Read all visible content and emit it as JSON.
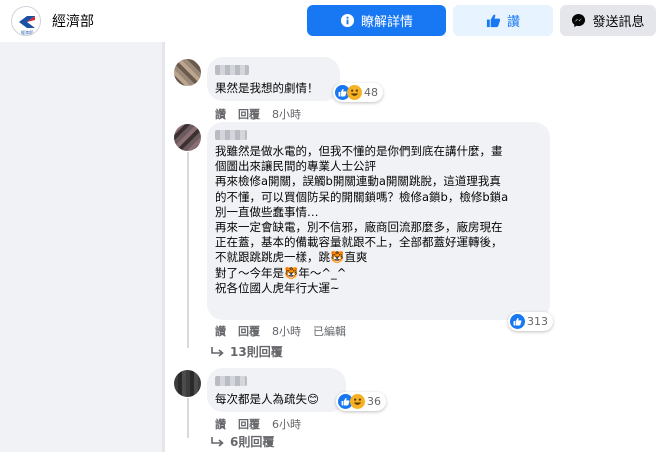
{
  "header": {
    "logo_text": "經濟部",
    "page_name": "經濟部",
    "learn_more": "瞭解詳情",
    "like": "讚",
    "send_message": "發送訊息"
  },
  "comments": [
    {
      "text": "果然是我想的劇情！",
      "reaction_count": "48",
      "actions": [
        "讚",
        "回覆",
        "8小時"
      ]
    },
    {
      "lines": [
        "我雖然是做水電的，但我不懂的是你們到底在講什麼，畫",
        "個圖出來讓民間的專業人士公評",
        "再來檢修a開關，誤觸b開關連動a開關跳脫，這道理我真",
        "的不懂，可以買個防呆的開關鎖嗎？檢修a鎖b，檢修b鎖a",
        "別一直做些蠢事情…",
        "再來一定會缺電，別不信邪，廠商回流那麼多，廠房現在",
        "正在蓋，基本的備載容量就跟不上，全部都蓋好運轉後，",
        "不就跟跳跳虎一樣，跳🐯直爽",
        "對了～今年是🐯年～^_^",
        "祝各位國人虎年行大運~"
      ],
      "reaction_count": "313",
      "actions": [
        "讚",
        "回覆",
        "8小時",
        "已編輯"
      ],
      "replies": "13則回覆"
    },
    {
      "text": "每次都是人為疏失😊",
      "reaction_count": "36",
      "actions": [
        "讚",
        "回覆",
        "6小時"
      ],
      "replies": "6則回覆"
    }
  ],
  "colors": {
    "primary": "#1877f2",
    "bubble": "#f0f2f5",
    "secondary_text": "#65676b"
  }
}
